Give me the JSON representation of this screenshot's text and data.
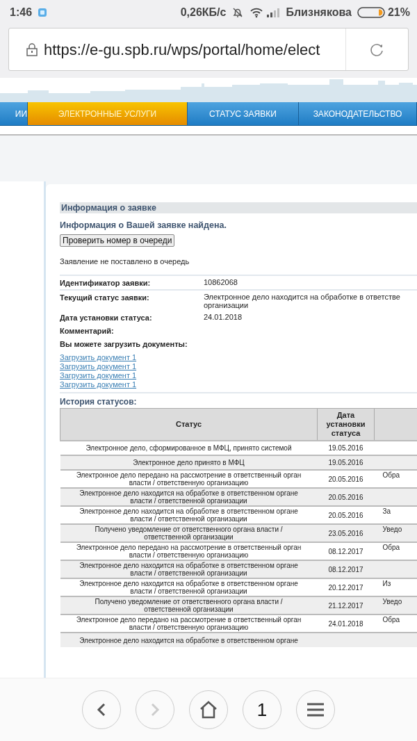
{
  "status_bar": {
    "time": "1:46",
    "speed": "0,26КБ/с",
    "carrier": "Близнякова",
    "battery": "21%"
  },
  "address_bar": {
    "url": "https://e-gu.spb.ru/wps/portal/home/elect"
  },
  "nav": [
    {
      "label": "ИИ",
      "selected": false
    },
    {
      "label": "ЭЛЕКТРОННЫЕ УСЛУГИ",
      "selected": true
    },
    {
      "label": "СТАТУС ЗАЯВКИ",
      "selected": false
    },
    {
      "label": "ЗАКОНОДАТЕЛЬСТВО",
      "selected": false
    }
  ],
  "panel": {
    "title": "Информация о заявке",
    "found": "Информация о Вашей заявке найдена.",
    "queue_button": "Проверить номер в очереди",
    "queue_note": "Заявление не поставлено в очередь",
    "fields": [
      {
        "label": "Идентификатор заявки:",
        "value": "10862068"
      },
      {
        "label": "Текущий статус заявки:",
        "value": "Электронное дело находится на обработке в ответстве\nорганизации"
      },
      {
        "label": "Дата установки статуса:",
        "value": "24.01.2018"
      },
      {
        "label": "Комментарий:"
      },
      {
        "label": "Вы можете загрузить документы:"
      }
    ],
    "links": [
      "Загрузить документ 1",
      "Загрузить документ 1",
      "Загрузить документ 1",
      "Загрузить документ 1"
    ]
  },
  "history": {
    "title": "История статусов:",
    "columns": [
      "Статус",
      "Дата установки статуса"
    ],
    "rows": [
      {
        "status": "Электронное дело, сформированное в МФЦ, принято системой",
        "date": "19.05.2016"
      },
      {
        "status": "Электронное дело принято в МФЦ",
        "date": "19.05.2016"
      },
      {
        "status": "Электронное дело передано на рассмотрение в ответственный орган власти / ответственную организацию",
        "date": "20.05.2016",
        "column_3": "Обра"
      },
      {
        "status": "Электронное дело находится на обработке в ответственном органе власти / ответственной организации",
        "date": "20.05.2016"
      },
      {
        "status": "Электронное дело находится на обработке в ответственном органе власти / ответственной организации",
        "date": "20.05.2016",
        "column_3": "За"
      },
      {
        "status": "Получено уведомление от ответственного органа власти / ответственной организации",
        "date": "23.05.2016",
        "column_3": "Уведо"
      },
      {
        "status": "Электронное дело передано на рассмотрение в ответственный орган власти / ответственную организацию",
        "date": "08.12.2017",
        "column_3": "Обра"
      },
      {
        "status": "Электронное дело находится на обработке в ответственном органе власти / ответственной организации",
        "date": "08.12.2017"
      },
      {
        "status": "Электронное дело находится на обработке в ответственном органе власти / ответственной организации",
        "date": "20.12.2017",
        "column_3": "Из"
      },
      {
        "status": "Получено уведомление от ответственного органа власти / ответственной организации",
        "date": "21.12.2017",
        "column_3": "Уведо"
      },
      {
        "status": "Электронное дело передано на рассмотрение в ответственный орган власти / ответственную организацию",
        "date": "24.01.2018",
        "column_3": "Обра"
      },
      {
        "status": "Электронное дело находится на обработке в ответственном органе",
        "date": ""
      }
    ]
  },
  "tab_count": "1"
}
